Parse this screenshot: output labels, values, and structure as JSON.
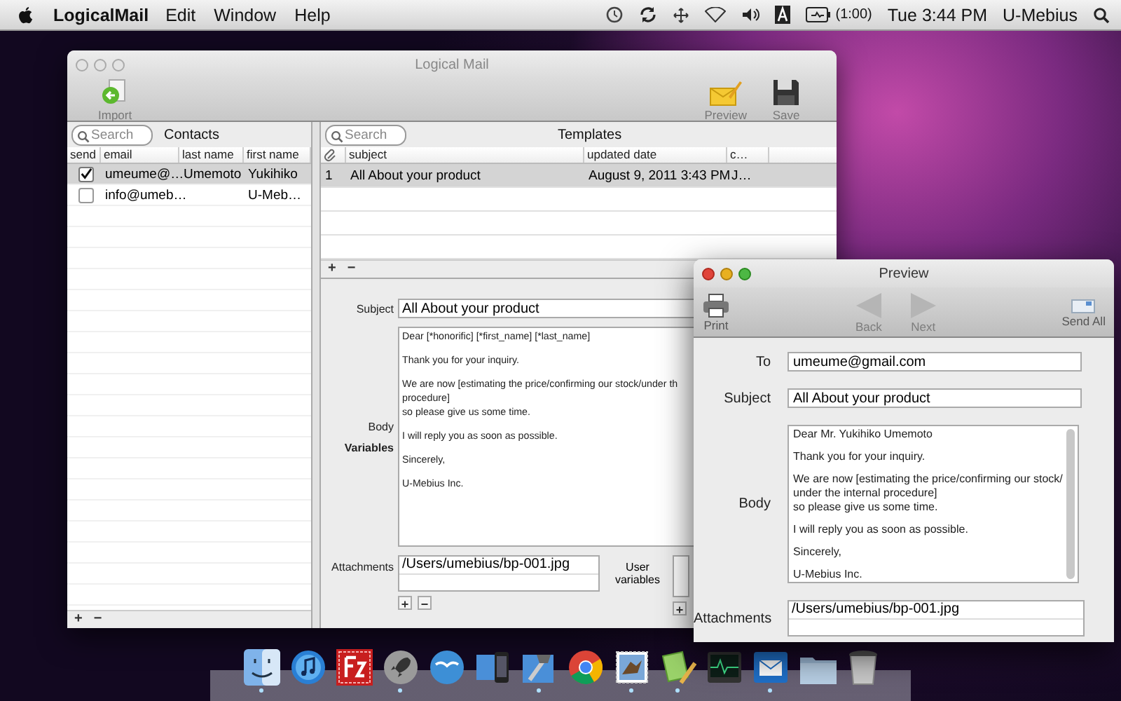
{
  "menu_bar": {
    "app_name": "LogicalMail",
    "menus": [
      "Edit",
      "Window",
      "Help"
    ],
    "battery_time": "(1:00)",
    "clock": "Tue 3:44 PM",
    "user": "U-Mebius"
  },
  "main_window": {
    "title": "Logical Mail",
    "toolbar": [
      {
        "kind": "import",
        "label": "Import"
      },
      {
        "kind": "preview",
        "label": "Preview"
      },
      {
        "kind": "save",
        "label": "Save"
      }
    ],
    "contacts": {
      "search_placeholder": "Search",
      "title": "Contacts",
      "columns": [
        "send",
        "email",
        "last name",
        "first name"
      ],
      "rows": [
        {
          "checked": true,
          "selected": true,
          "email": "umeume@…",
          "last_name": "Umemoto",
          "first_name": "Yukihiko"
        },
        {
          "checked": false,
          "selected": false,
          "email": "info@umeb…",
          "first_name": "U-Meb…"
        }
      ],
      "add": "+",
      "remove": "−"
    },
    "templates": {
      "search_placeholder": "Search",
      "title": "Templates",
      "columns": [
        "subject",
        "updated date",
        "c…"
      ],
      "rows": [
        {
          "number": "1",
          "subject": "All About your product",
          "updated_date": "August 9, 2011 3:43 PM",
          "column_4": "J…",
          "selected": true
        }
      ],
      "add": "+",
      "remove": "−"
    },
    "editor": {
      "subject_label": "Subject",
      "subject": "All About your product",
      "body_label": "Body",
      "variables_label": "Variables",
      "body_paragraphs": [
        [
          "Dear [*honorific] [*first_name] [*last_name]"
        ],
        [
          "Thank you for your inquiry."
        ],
        [
          "We are now [estimating the price/confirming our stock/under th",
          "procedure]",
          "so please give us some time."
        ],
        [
          "I will reply you as soon as possible."
        ],
        [
          "Sincerely,"
        ],
        [
          "U-Mebius Inc."
        ]
      ],
      "attachments_label": "Attachments",
      "attachments": [
        "/Users/umebius/bp-001.jpg"
      ],
      "add": "+",
      "remove": "−",
      "user_variables_label": "User variables",
      "user_variables_add": "+"
    }
  },
  "preview_window": {
    "title": "Preview",
    "toolbar": [
      {
        "kind": "print",
        "label": "Print",
        "disabled": false
      },
      {
        "kind": "back",
        "label": "Back",
        "disabled": true
      },
      {
        "kind": "next",
        "label": "Next",
        "disabled": true
      },
      {
        "kind": "send_all",
        "label": "Send All",
        "disabled": false
      }
    ],
    "to_label": "To",
    "to": "umeume@gmail.com",
    "subject_label": "Subject",
    "subject": "All About your product",
    "body_label": "Body",
    "body_paragraphs": [
      [
        "Dear Mr. Yukihiko Umemoto"
      ],
      [
        "Thank you for your inquiry."
      ],
      [
        "We are now [estimating the price/confirming our stock/",
        "under the internal procedure]",
        "so please give us some time."
      ],
      [
        "I will reply you as soon as possible."
      ],
      [
        "Sincerely,"
      ],
      [
        "U-Mebius Inc."
      ]
    ],
    "attachments_label": "Attachments",
    "attachments": [
      "/Users/umebius/bp-001.jpg"
    ]
  },
  "dock": [
    {
      "kind": "finder",
      "running": true
    },
    {
      "kind": "music",
      "running": false
    },
    {
      "kind": "ftp",
      "running": false
    },
    {
      "kind": "rocket",
      "running": true
    },
    {
      "kind": "office",
      "running": false
    },
    {
      "kind": "simulator",
      "running": false
    },
    {
      "kind": "hammer",
      "running": true
    },
    {
      "kind": "browser",
      "running": false
    },
    {
      "kind": "stamp",
      "running": true
    },
    {
      "kind": "notepad",
      "running": true
    },
    {
      "kind": "monitor",
      "running": false
    },
    {
      "kind": "mail",
      "running": true
    },
    {
      "kind": "folder",
      "running": false
    },
    {
      "kind": "trash",
      "running": false
    }
  ]
}
